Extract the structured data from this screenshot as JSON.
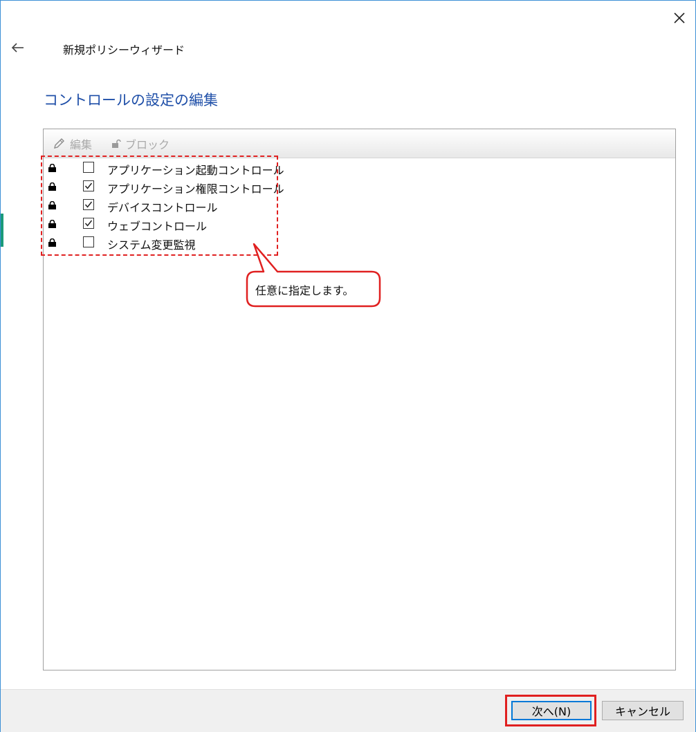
{
  "window": {
    "title": "新規ポリシーウィザード",
    "close_icon": "close-icon",
    "back_icon": "back-arrow-icon"
  },
  "page": {
    "heading": "コントロールの設定の編集"
  },
  "toolbar": {
    "edit_label": "編集",
    "block_label": "ブロック"
  },
  "controls": [
    {
      "label": "アプリケーション起動コントロール",
      "checked": false,
      "locked": true
    },
    {
      "label": "アプリケーション権限コントロール",
      "checked": true,
      "locked": true
    },
    {
      "label": "デバイスコントロール",
      "checked": true,
      "locked": true
    },
    {
      "label": "ウェブコントロール",
      "checked": true,
      "locked": true
    },
    {
      "label": "システム変更監視",
      "checked": false,
      "locked": true
    }
  ],
  "annotation": {
    "callout_text": "任意に指定します。"
  },
  "footer": {
    "next_label": "次へ(N)",
    "cancel_label": "キャンセル"
  },
  "colors": {
    "heading": "#1f4fa8",
    "highlight": "#e02020",
    "focus": "#0078d7",
    "window_border": "#3c8fd6"
  }
}
